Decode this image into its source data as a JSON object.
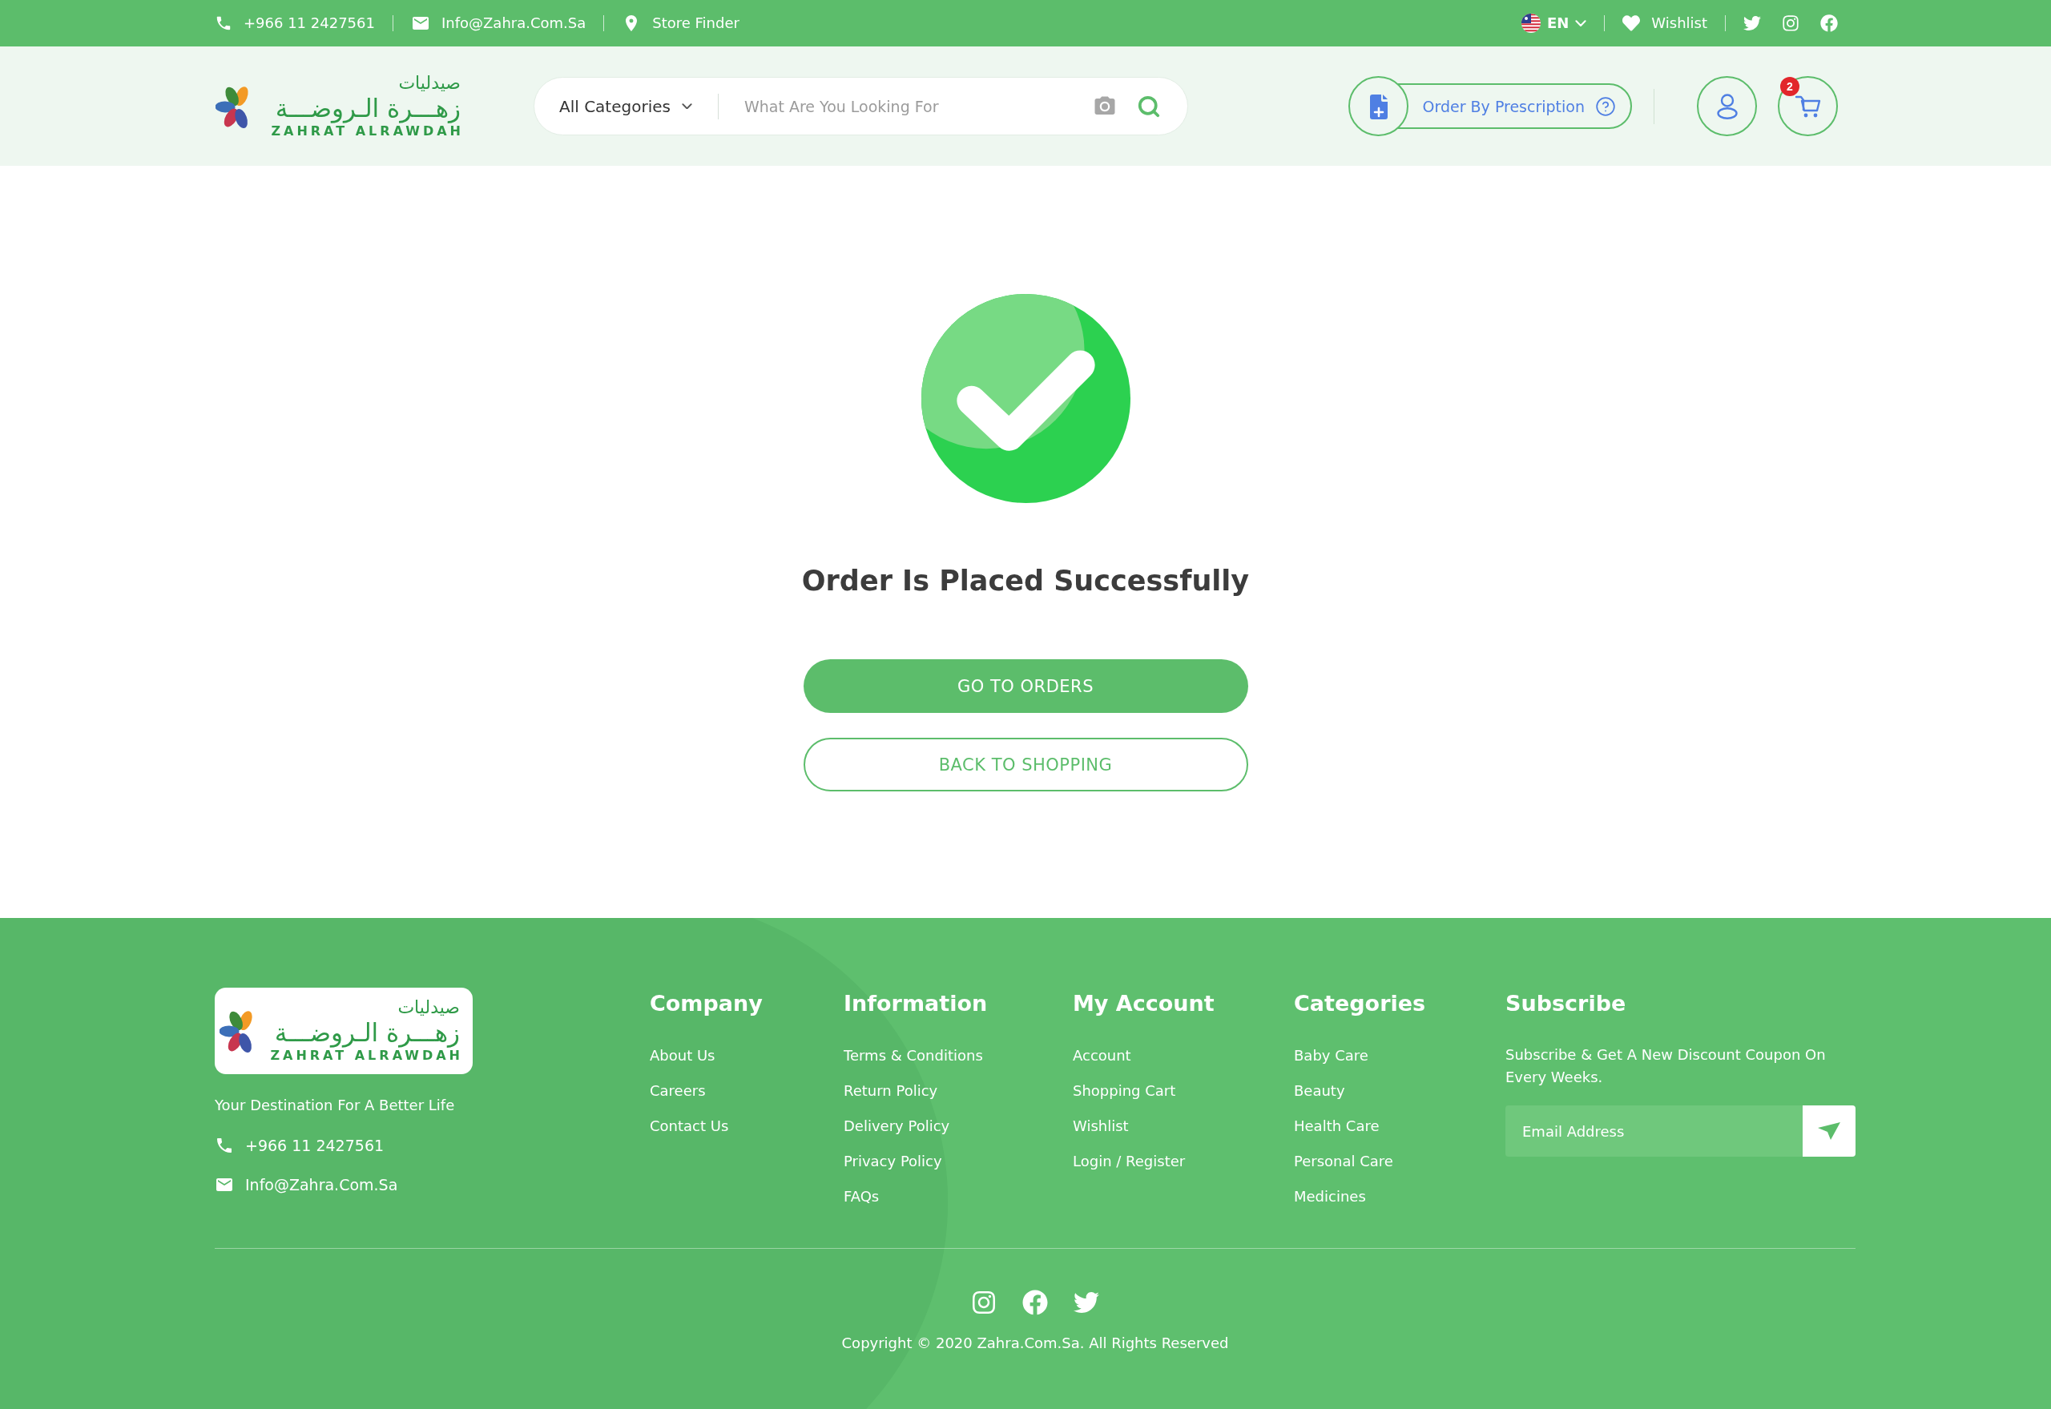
{
  "top_bar": {
    "phone": "+966 11 2427561",
    "email": "Info@Zahra.Com.Sa",
    "store_finder": "Store Finder",
    "language": "EN",
    "wishlist": "Wishlist"
  },
  "header": {
    "logo": {
      "arabic_title": "صيدليات",
      "arabic_name": "زهـــرة الـروضـــة",
      "latin_name": "ZAHRAT ALRAWDAH"
    },
    "search": {
      "category": "All Categories",
      "placeholder": "What Are You Looking For"
    },
    "prescription_button": "Order By Prescription",
    "cart_count": "2"
  },
  "confirmation": {
    "title": "Order Is Placed Successfully",
    "buttons": [
      {
        "label": "GO TO ORDERS",
        "kind": "primary"
      },
      {
        "label": "BACK TO SHOPPING",
        "kind": "outline"
      }
    ]
  },
  "footer": {
    "logo": {
      "arabic_title": "صيدليات",
      "arabic_name": "زهـــرة الـروضـــة",
      "latin_name": "ZAHRAT ALRAWDAH"
    },
    "tagline": "Your Destination For A Better Life",
    "phone": "+966 11 2427561",
    "email": "Info@Zahra.Com.Sa",
    "columns": [
      {
        "title": "Company",
        "links": [
          "About Us",
          "Careers",
          "Contact Us"
        ]
      },
      {
        "title": "Information",
        "links": [
          "Terms & Conditions",
          "Return Policy",
          "Delivery Policy",
          "Privacy Policy",
          "FAQs"
        ]
      },
      {
        "title": "My Account",
        "links": [
          "Account",
          "Shopping Cart",
          "Wishlist",
          "Login / Register"
        ]
      },
      {
        "title": "Categories",
        "links": [
          "Baby Care",
          "Beauty",
          "Health Care",
          "Personal Care",
          "Medicines"
        ]
      }
    ],
    "subscribe": {
      "title": "Subscribe",
      "text": "Subscribe & Get A New Discount Coupon On Every Weeks.",
      "placeholder": "Email Address"
    },
    "copyright": "Copyright © 2020 Zahra.Com.Sa. All Rights Reserved"
  }
}
